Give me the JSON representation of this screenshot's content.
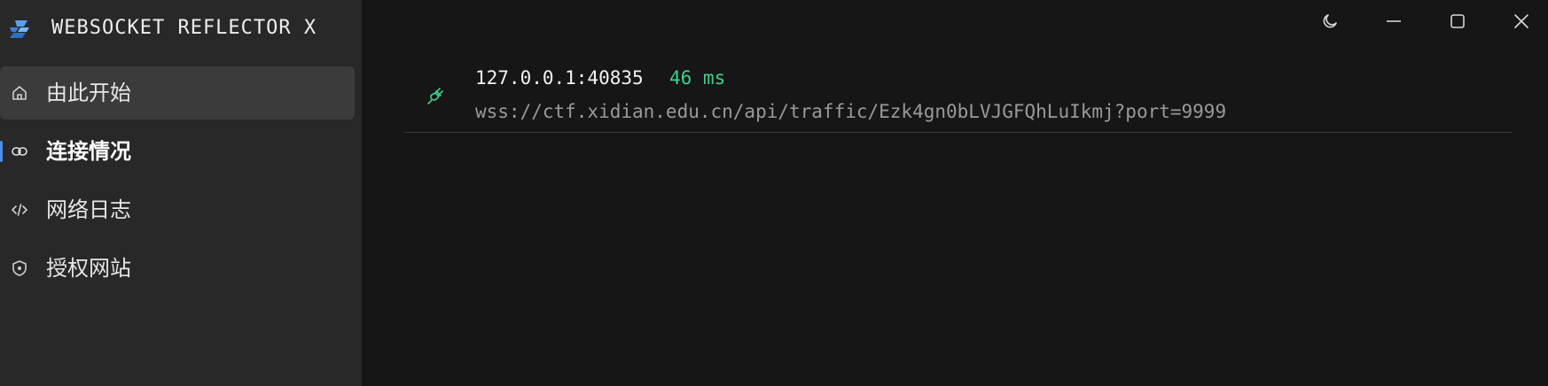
{
  "app": {
    "title": "WEBSOCKET REFLECTOR X",
    "logo_icon": "websocket-logo-icon",
    "accent_color": "#4c8fe8"
  },
  "sidebar": {
    "items": [
      {
        "label": "由此开始",
        "icon": "home-icon",
        "state": "hover"
      },
      {
        "label": "连接情况",
        "icon": "link-icon",
        "state": "active"
      },
      {
        "label": "网络日志",
        "icon": "code-icon",
        "state": "normal"
      },
      {
        "label": "授权网站",
        "icon": "shield-icon",
        "state": "normal"
      }
    ]
  },
  "titlebar": {
    "buttons": [
      "theme-moon-icon",
      "minimize-icon",
      "maximize-icon",
      "close-icon"
    ]
  },
  "connections": [
    {
      "address": "127.0.0.1:40835",
      "latency": "46 ms",
      "url": "wss://ctf.xidian.edu.cn/api/traffic/Ezk4gn0bLVJGFQhLuIkmj?port=9999",
      "icon": "plug-connected-icon",
      "latency_color": "#3ecf8e"
    }
  ]
}
